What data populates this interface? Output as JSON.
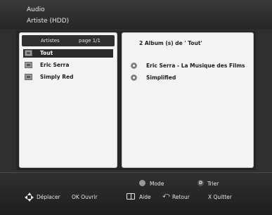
{
  "header": {
    "line1": "Audio",
    "line2": "Artiste (HDD)"
  },
  "artists_panel": {
    "title": "Artistes",
    "page": "page 1/1",
    "items": [
      {
        "label": "Tout",
        "selected": true
      },
      {
        "label": "Eric Serra",
        "selected": false
      },
      {
        "label": "Simply Red",
        "selected": false
      }
    ]
  },
  "albums_panel": {
    "title": "2 Album (s) de ' Tout'",
    "items": [
      {
        "label": "Eric Serra - La Musique des Films"
      },
      {
        "label": "Simplified"
      }
    ]
  },
  "footer": {
    "mode": {
      "key": "",
      "label": "Mode"
    },
    "trier": {
      "key": "D",
      "label": "Trier"
    },
    "deplacer": "Déplacer",
    "ok": "OK Ouvrir",
    "aide": "Aide",
    "retour": "Retour",
    "quitter": "X  Quitter"
  },
  "icons": [
    "dpad-icon",
    "folder-icon",
    "disc-icon",
    "book-icon",
    "back-arrow-icon"
  ],
  "colors": {
    "background": "#2f2f2f",
    "panel": "#f3f3f3",
    "selection": "#2a2a2a",
    "text_light": "#e6e6e6"
  }
}
